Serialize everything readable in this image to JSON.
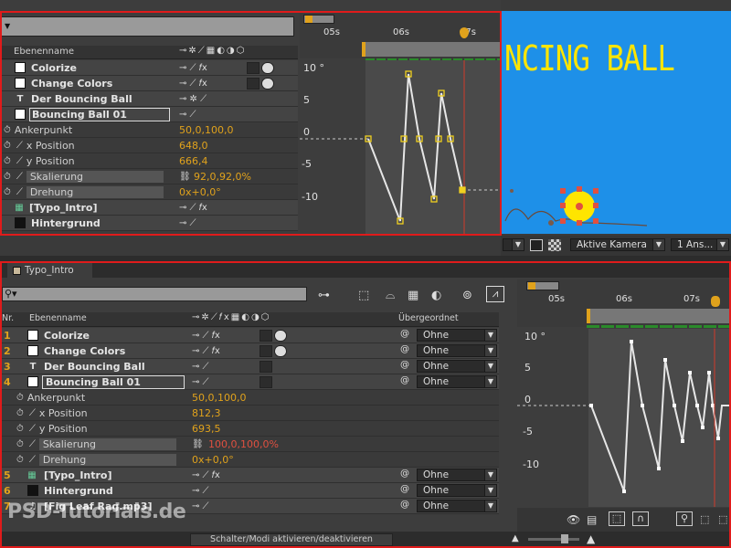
{
  "top": {
    "column_header": "Ebenenname",
    "layers": [
      {
        "name": "Colorize",
        "color": "#ffffff"
      },
      {
        "name": "Change Colors",
        "color": "#ffffff"
      },
      {
        "name": "Der Bouncing Ball",
        "color": ""
      },
      {
        "name": "Bouncing Ball 01",
        "color": "#ffffff"
      }
    ],
    "props": [
      {
        "label": "Ankerpunkt",
        "value": "50,0,100,0"
      },
      {
        "label": "x Position",
        "value": "648,0"
      },
      {
        "label": "y Position",
        "value": "666,4"
      },
      {
        "label": "Skalierung",
        "value": "92,0,92,0%"
      },
      {
        "label": "Drehung",
        "value": "0x+0,0°"
      }
    ],
    "layers2": [
      {
        "name": "[Typo_Intro]"
      },
      {
        "name": "Hintergrund"
      }
    ],
    "ruler": [
      "05s",
      "06s",
      "07s"
    ],
    "graph_labels": [
      "10 °",
      "5",
      "0",
      "-5",
      "-10"
    ],
    "preview_title": "NCING BALL",
    "camera_dropdown": "Aktive Kamera",
    "view_dropdown": "1 Ans..."
  },
  "bottom": {
    "tab_title": "Typo_Intro",
    "col_nr": "Nr.",
    "col_name": "Ebenenname",
    "col_parent": "Übergeordnet",
    "layers": [
      {
        "nr": "1",
        "name": "Colorize",
        "parent": "Ohne",
        "color": "#ffffff"
      },
      {
        "nr": "2",
        "name": "Change Colors",
        "parent": "Ohne",
        "color": "#ffffff"
      },
      {
        "nr": "3",
        "name": "Der Bouncing Ball",
        "parent": "Ohne",
        "color": ""
      },
      {
        "nr": "4",
        "name": "Bouncing Ball 01",
        "parent": "Ohne",
        "color": "#ffffff"
      }
    ],
    "props": [
      {
        "label": "Ankerpunkt",
        "value": "50,0,100,0"
      },
      {
        "label": "x Position",
        "value": "812,3"
      },
      {
        "label": "y Position",
        "value": "693,5"
      },
      {
        "label": "Skalierung",
        "value": "100,0,100,0%"
      },
      {
        "label": "Drehung",
        "value": "0x+0,0°"
      }
    ],
    "layers2": [
      {
        "nr": "5",
        "name": "[Typo_Intro]",
        "parent": "Ohne"
      },
      {
        "nr": "6",
        "name": "Hintergrund",
        "parent": "Ohne"
      },
      {
        "nr": "7",
        "name": "[Fig Leaf Rag.mp3]",
        "parent": "Ohne"
      }
    ],
    "ruler": [
      "05s",
      "06s",
      "07s"
    ],
    "graph_labels": [
      "10 °",
      "5",
      "0",
      "-5",
      "-10"
    ],
    "toggle_button": "Schalter/Modi aktivieren/deaktivieren",
    "watermark": "PSD-Tutorials.de"
  },
  "colors": {
    "accent": "#e0a21c",
    "frame": "#e01b1b",
    "preview_bg": "#1e90e8",
    "ball": "#ffe500",
    "keyframe": "#f0d020",
    "playhead": "#d03a2a"
  }
}
